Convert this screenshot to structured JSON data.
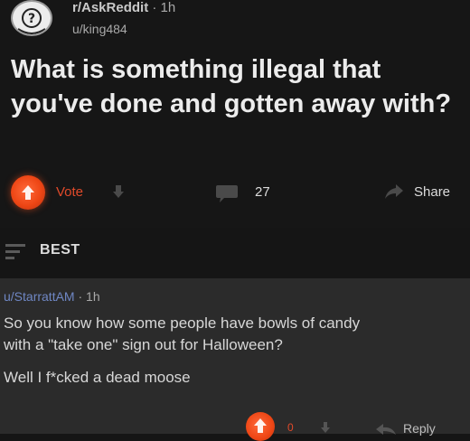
{
  "post": {
    "subreddit": "r/AskReddit",
    "time": "· 1h",
    "username": "u/king484",
    "title": "What is something illegal that you've done and gotten away with?",
    "vote_label": "Vote",
    "comment_count": "27",
    "share_label": "Share"
  },
  "sort": {
    "label": "BEST"
  },
  "comment": {
    "author": "u/StarrattAM",
    "time": "· 1h",
    "line1": "So you know how some people have bowls of candy",
    "line2": "with a \"take one\" sign out for Halloween?",
    "line3": "Well I f*cked a dead moose",
    "vote_count": "0",
    "reply_label": "Reply"
  },
  "colors": {
    "background": "#151515",
    "upvote": "#ee4615",
    "author_link": "#6f87c4",
    "comment_bg": "#2b2b2b"
  },
  "icons": {
    "avatar": "snoo-avatar-icon",
    "upvote": "upvote-arrow-icon",
    "downvote": "downvote-arrow-icon",
    "comment": "comment-bubble-icon",
    "share": "share-arrow-icon",
    "sort": "sort-lines-icon",
    "reply": "reply-arrow-icon"
  }
}
